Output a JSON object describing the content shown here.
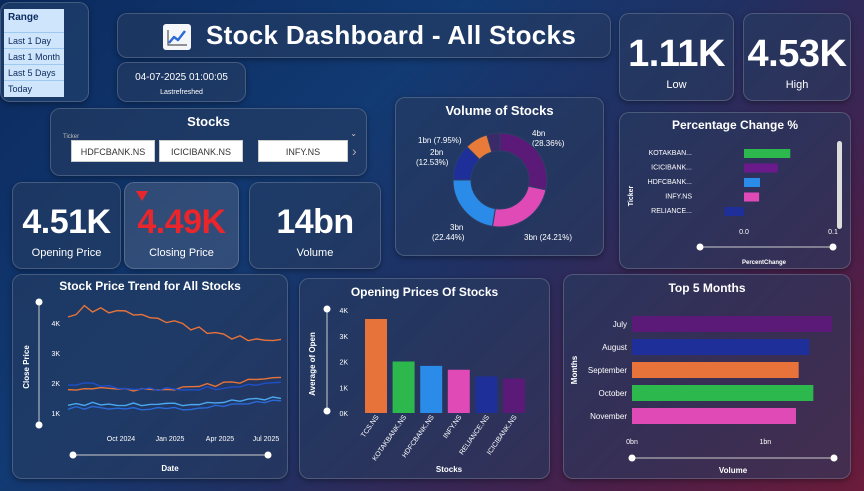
{
  "range_slicer": {
    "title": "Range",
    "options": [
      "Last 1 Day",
      "Last 1 Month",
      "Last 5 Days",
      "Today"
    ]
  },
  "header": {
    "title": "Stock Dashboard - All Stocks",
    "icon": "chart-trend-icon"
  },
  "refresh": {
    "timestamp": "04-07-2025 01:00:05",
    "label": "Lastrefreshed"
  },
  "kpis": {
    "low": {
      "value": "1.11K",
      "label": "Low"
    },
    "high": {
      "value": "4.53K",
      "label": "High"
    },
    "opening": {
      "value": "4.51K",
      "label": "Opening Price"
    },
    "closing": {
      "value": "4.49K",
      "label": "Closing Price",
      "color": "#e8262b"
    },
    "volume": {
      "value": "14bn",
      "label": "Volume"
    }
  },
  "stocks_slicer": {
    "title": "Stocks",
    "field_label": "Ticker",
    "tickers": [
      "HDFCBANK.NS",
      "ICICIBANK.NS",
      "INFY.NS"
    ]
  },
  "volume_donut": {
    "title": "Volume of Stocks",
    "labels": {
      "l1": "1bn (7.95%)",
      "l2a": "2bn",
      "l2b": "(12.53%)",
      "l3a": "4bn",
      "l3b": "(28.36%)",
      "l4": "3bn (24.21%)",
      "l5a": "3bn",
      "l5b": "(22.44%)"
    }
  },
  "pct_change": {
    "title": "Percentage Change %",
    "ylabel": "Ticker",
    "xlabel": "PercentChange",
    "ticks": [
      "0.0",
      "0.1"
    ]
  },
  "price_trend": {
    "title": "Stock Price Trend for All Stocks",
    "ylabel": "Close Price",
    "xlabel": "Date"
  },
  "opening_prices": {
    "title": "Opening Prices Of Stocks",
    "ylabel": "Average of Open",
    "xlabel": "Stocks"
  },
  "top_months": {
    "title": "Top 5 Months",
    "ylabel": "Months",
    "xlabel": "Volume"
  },
  "chart_data": [
    {
      "type": "pie",
      "title": "Volume of Stocks",
      "slices": [
        {
          "label": "4bn (28.36%)",
          "value": 28.36,
          "color": "#5b1a78"
        },
        {
          "label": "3bn (24.21%)",
          "value": 24.21,
          "color": "#e04ab6"
        },
        {
          "label": "3bn (22.44%)",
          "value": 22.44,
          "color": "#2a8be8"
        },
        {
          "label": "2bn (12.53%)",
          "value": 12.53,
          "color": "#1f2f9a"
        },
        {
          "label": "1bn (7.95%)",
          "value": 7.95,
          "color": "#e87a3a"
        },
        {
          "label": "",
          "value": 4.51,
          "color": "#3a2a6a"
        }
      ]
    },
    {
      "type": "bar",
      "title": "Percentage Change %",
      "categories": [
        "KOTAKBAN...",
        "ICICIBANK...",
        "HDFCBANK...",
        "INFY.NS",
        "RELIANCE..."
      ],
      "values": [
        0.052,
        0.038,
        0.018,
        0.017,
        -0.022
      ],
      "colors": [
        "#2db84d",
        "#6a1a8a",
        "#2a8be8",
        "#e04ab6",
        "#1f2f9a"
      ],
      "xlim": [
        -0.02,
        0.1
      ]
    },
    {
      "type": "line",
      "title": "Stock Price Trend for All Stocks",
      "xlabel": "Date",
      "ylabel": "Close Price",
      "x_ticks": [
        "Oct 2024",
        "Jan 2025",
        "Apr 2025",
        "Jul 2025"
      ],
      "y_ticks": [
        "1K",
        "2K",
        "3K",
        "4K"
      ],
      "ylim": [
        600,
        4600
      ],
      "series": [
        {
          "color": "#e8733a",
          "values": [
            4200,
            4300,
            4550,
            4400,
            4480,
            4350,
            4420,
            4380,
            4300,
            4250,
            4200,
            4150,
            4000,
            4100,
            3950,
            3800,
            3850,
            3650,
            3700,
            3600,
            3500,
            3550,
            3420,
            3480,
            3400,
            3450,
            3420
          ]
        },
        {
          "color": "#e8733a",
          "values": [
            1750,
            1800,
            1780,
            1820,
            1850,
            1800,
            1830,
            1780,
            1760,
            1800,
            1780,
            1790,
            1750,
            1800,
            1850,
            1880,
            1900,
            1950,
            1920,
            2000,
            2050,
            2000,
            2100,
            2150,
            2100,
            2200,
            2180
          ]
        },
        {
          "color": "#1f4fc8",
          "values": [
            1900,
            1950,
            2000,
            1980,
            1920,
            1880,
            1850,
            1800,
            1780,
            1820,
            1800,
            1780,
            1820,
            1800,
            1780,
            1750,
            1800,
            1850,
            1800,
            1820,
            1850,
            1900,
            1920,
            1950,
            1980,
            2000,
            2050
          ]
        },
        {
          "color": "#4aa8f0",
          "values": [
            1250,
            1300,
            1280,
            1320,
            1300,
            1280,
            1250,
            1270,
            1300,
            1280,
            1260,
            1300,
            1330,
            1300,
            1280,
            1250,
            1300,
            1350,
            1320,
            1380,
            1400,
            1420,
            1450,
            1480,
            1460,
            1500,
            1520
          ]
        },
        {
          "color": "#2a6ad8",
          "values": [
            1150,
            1180,
            1160,
            1200,
            1180,
            1150,
            1130,
            1170,
            1150,
            1120,
            1130,
            1160,
            1180,
            1150,
            1130,
            1110,
            1150,
            1200,
            1220,
            1250,
            1280,
            1300,
            1320,
            1350,
            1380,
            1400,
            1420
          ]
        }
      ]
    },
    {
      "type": "bar",
      "title": "Opening Prices Of Stocks",
      "xlabel": "Stocks",
      "ylabel": "Average of Open",
      "categories": [
        "TCS.NS",
        "KOTAKBANK.NS",
        "HDFCBANK.NS",
        "INFY.NS",
        "RELIANCE.NS",
        "ICICIBANK.NS"
      ],
      "values": [
        3650,
        2000,
        1830,
        1680,
        1420,
        1340
      ],
      "colors": [
        "#e8733a",
        "#2db84d",
        "#2a8be8",
        "#e04ab6",
        "#1f2f9a",
        "#5b1a78"
      ],
      "y_ticks": [
        "0K",
        "1K",
        "2K",
        "3K",
        "4K"
      ],
      "ylim": [
        0,
        4000
      ]
    },
    {
      "type": "bar",
      "title": "Top 5 Months",
      "xlabel": "Volume",
      "ylabel": "Months",
      "categories": [
        "July",
        "August",
        "September",
        "October",
        "November"
      ],
      "values": [
        1.5,
        1.33,
        1.25,
        1.36,
        1.23
      ],
      "colors": [
        "#5b1a78",
        "#1f2f9a",
        "#e8733a",
        "#2db84d",
        "#e04ab6"
      ],
      "x_ticks": [
        "0bn",
        "1bn"
      ],
      "xlim": [
        0,
        1.5
      ]
    }
  ]
}
